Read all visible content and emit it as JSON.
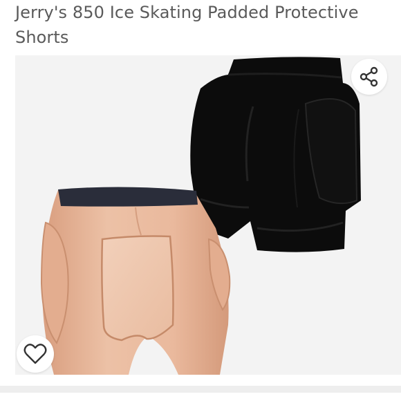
{
  "product": {
    "title": "Jerry's 850 Ice Skating Padded Protective Shorts"
  },
  "image": {
    "background_color": "#f3f3f3",
    "black_shorts_color": "#0c0c0c",
    "skin_shorts_color": "#e8b79a"
  },
  "actions": {
    "share_icon": "share-icon",
    "wishlist_icon": "heart-outline-icon"
  },
  "colors": {
    "title_text": "#5a5a5a",
    "icon_stroke": "#333333",
    "divider": "#eeeeee"
  }
}
